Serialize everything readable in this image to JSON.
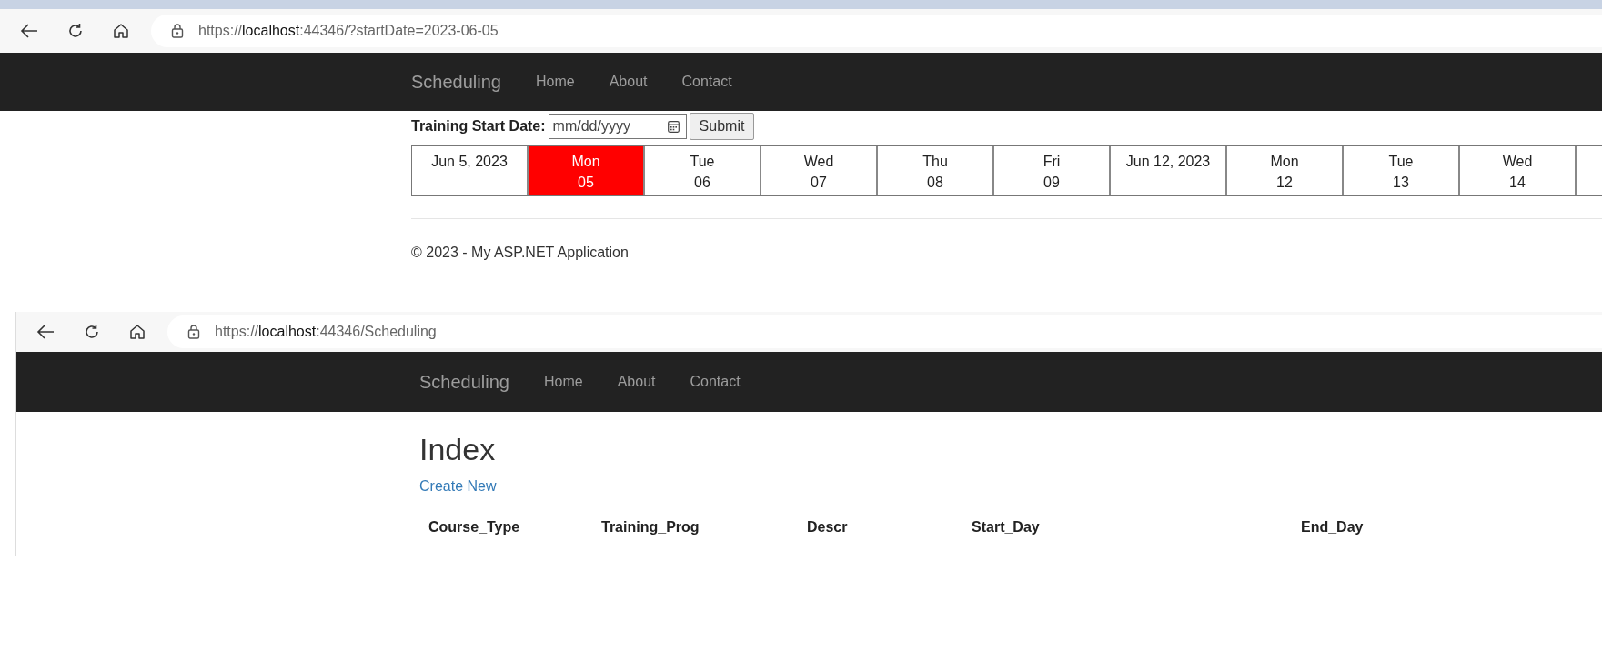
{
  "browsers": [
    {
      "url": {
        "scheme": "https://",
        "host": "localhost",
        "rest": ":44346/?startDate=2023-06-05"
      },
      "navbar": {
        "brand": "Scheduling",
        "links": [
          "Home",
          "About",
          "Contact"
        ]
      },
      "kind": "calendar",
      "form": {
        "label": "Training Start Date:",
        "placeholder": "mm/dd/yyyy",
        "submit": "Submit"
      },
      "calendar": [
        {
          "kind": "week",
          "label": "Jun 5, 2023"
        },
        {
          "kind": "day",
          "day": "Mon",
          "num": "05",
          "selected": true
        },
        {
          "kind": "day",
          "day": "Tue",
          "num": "06",
          "selected": false
        },
        {
          "kind": "day",
          "day": "Wed",
          "num": "07",
          "selected": false
        },
        {
          "kind": "day",
          "day": "Thu",
          "num": "08",
          "selected": false
        },
        {
          "kind": "day",
          "day": "Fri",
          "num": "09",
          "selected": false
        },
        {
          "kind": "week",
          "label": "Jun 12, 2023"
        },
        {
          "kind": "day",
          "day": "Mon",
          "num": "12",
          "selected": false
        },
        {
          "kind": "day",
          "day": "Tue",
          "num": "13",
          "selected": false
        },
        {
          "kind": "day",
          "day": "Wed",
          "num": "14",
          "selected": false
        }
      ],
      "footer": "© 2023 - My ASP.NET Application"
    },
    {
      "url": {
        "scheme": "https://",
        "host": "localhost",
        "rest": ":44346/Scheduling"
      },
      "navbar": {
        "brand": "Scheduling",
        "links": [
          "Home",
          "About",
          "Contact"
        ]
      },
      "kind": "index",
      "heading": "Index",
      "create_link": "Create New",
      "table": {
        "columns": [
          "Course_Type",
          "Training_Prog",
          "Descr",
          "Start_Day",
          "End_Day"
        ]
      }
    }
  ]
}
